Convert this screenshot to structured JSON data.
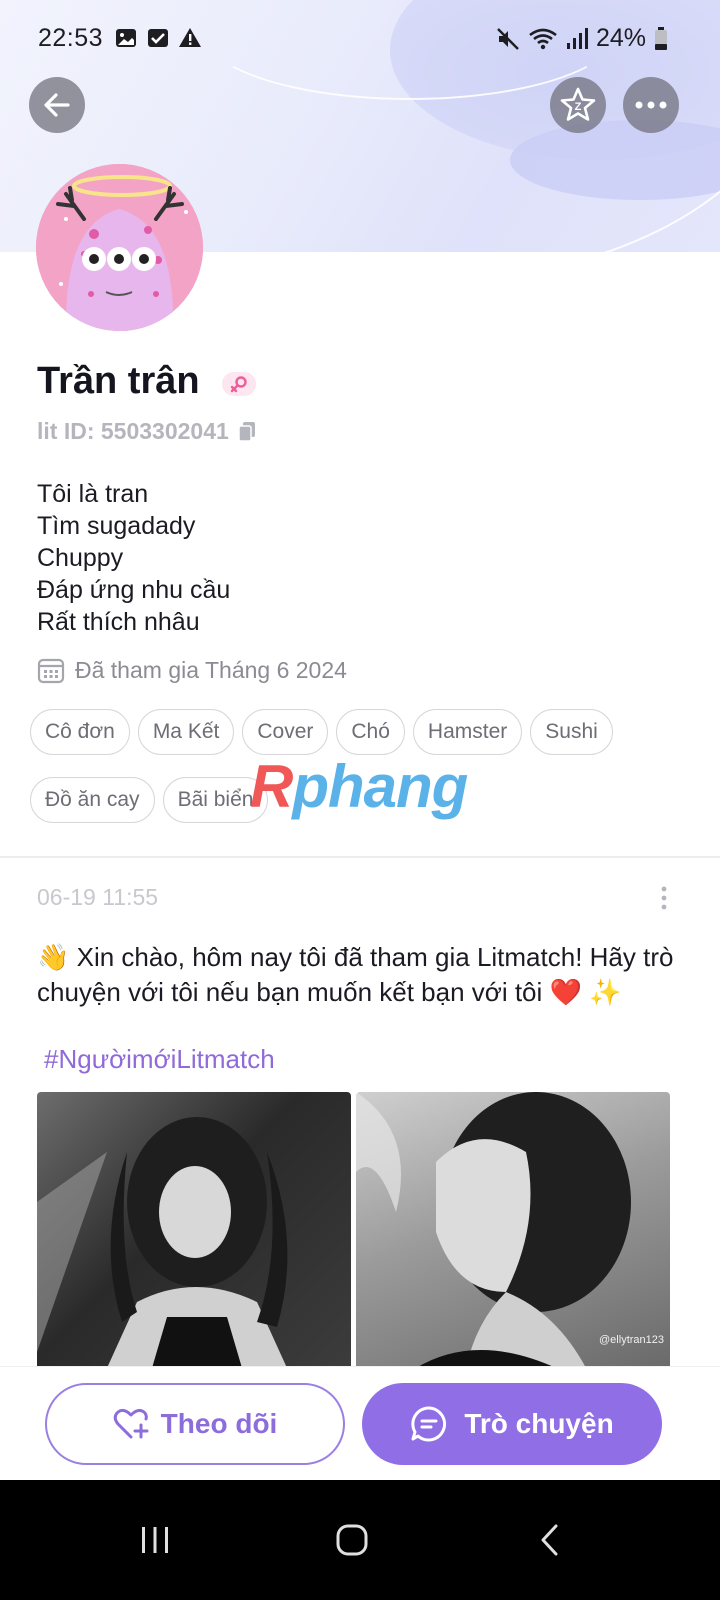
{
  "status_bar": {
    "time": "22:53",
    "battery": "24%"
  },
  "header": {
    "back_icon": "arrow-left-icon",
    "star_icon": "star-z-icon",
    "more_icon": "more-horizontal-icon"
  },
  "profile": {
    "name": "Trần trân",
    "lit_id": "lit ID: 5503302041",
    "bio": [
      "Tôi là tran",
      "Tìm sugadady",
      "Chuppy",
      "Đáp ứng nhu cầu",
      "Rất thích nhâu"
    ],
    "joined": "Đã tham gia Tháng 6 2024",
    "tags": [
      "Cô đơn",
      "Ma Kết",
      "Cover",
      "Chó",
      "Hamster",
      "Sushi",
      "Đồ ăn cay",
      "Bãi biển"
    ]
  },
  "watermark": {
    "first_letter": "R",
    "rest": "phang"
  },
  "post": {
    "time": "06-19 11:55",
    "text": "👋 Xin chào, hôm nay tôi đã tham gia Litmatch! Hãy trò chuyện với tôi nếu bạn muốn kết bạn với tôi ❤️ ✨",
    "hashtag": "#NgườimớiLitmatch",
    "photo_watermark": "@ellytran123"
  },
  "actions": {
    "follow_label": "Theo dõi",
    "chat_label": "Trò chuyện"
  },
  "colors": {
    "accent": "#8f6ee6",
    "hashtag": "#8f6ad8"
  }
}
